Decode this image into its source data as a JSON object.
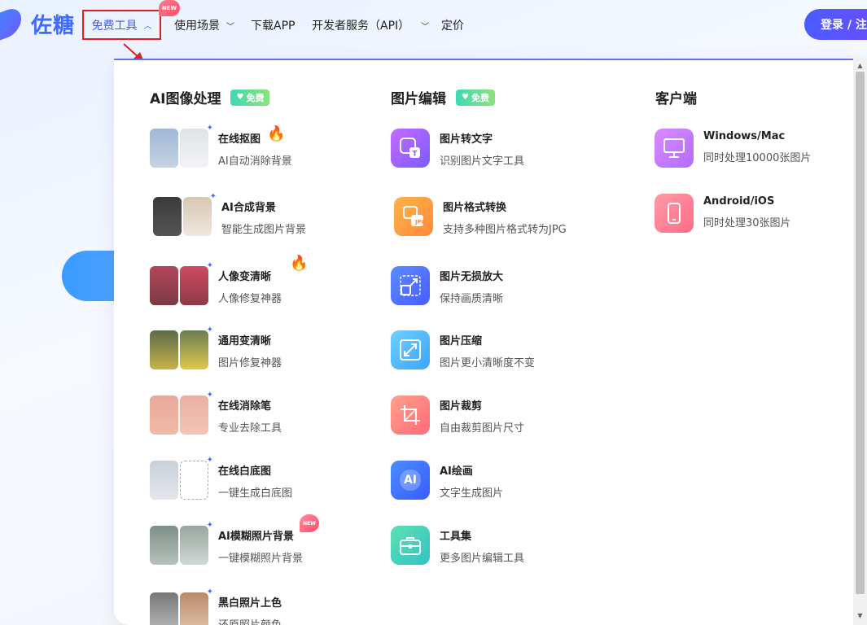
{
  "brand": {
    "name": "佐糖"
  },
  "nav": {
    "free_tools": "免费工具",
    "use_cases": "使用场景",
    "download": "下载APP",
    "dev_api": "开发者服务（API）",
    "pricing": "定价",
    "new_badge": "NEW",
    "login": "登录 / 注"
  },
  "columns": {
    "ai": {
      "title": "AI图像处理",
      "tag": "免费"
    },
    "edit": {
      "title": "图片编辑",
      "tag": "免费"
    },
    "client": {
      "title": "客户端"
    }
  },
  "ai_tools": [
    {
      "name": "在线抠图",
      "desc": "AI自动消除背景"
    },
    {
      "name": "AI合成背景",
      "desc": "智能生成图片背景"
    },
    {
      "name": "人像变清晰",
      "desc": "人像修复神器"
    },
    {
      "name": "通用变清晰",
      "desc": "图片修复神器"
    },
    {
      "name": "在线消除笔",
      "desc": "专业去除工具"
    },
    {
      "name": "在线白底图",
      "desc": "一键生成白底图"
    },
    {
      "name": "AI模糊照片背景",
      "desc": "一键模糊照片背景",
      "badge": "NEW"
    },
    {
      "name": "黑白照片上色",
      "desc": "还原照片颜色"
    }
  ],
  "edit_tools": [
    {
      "name": "图片转文字",
      "desc": "识别图片文字工具"
    },
    {
      "name": "图片格式转换",
      "desc": "支持多种图片格式转为JPG",
      "icon_text": "JPG"
    },
    {
      "name": "图片无损放大",
      "desc": "保持画质清晰"
    },
    {
      "name": "图片压缩",
      "desc": "图片更小清晰度不变"
    },
    {
      "name": "图片裁剪",
      "desc": "自由裁剪图片尺寸"
    },
    {
      "name": "AI绘画",
      "desc": "文字生成图片",
      "icon_text": "AI"
    },
    {
      "name": "工具集",
      "desc": "更多图片编辑工具"
    }
  ],
  "clients": [
    {
      "name": "Windows/Mac",
      "desc": "同时处理10000张图片"
    },
    {
      "name": "Android/iOS",
      "desc": "同时处理30张图片"
    }
  ],
  "colors": {
    "accent": "#3d5cff",
    "highlight_border": "#e02020"
  }
}
